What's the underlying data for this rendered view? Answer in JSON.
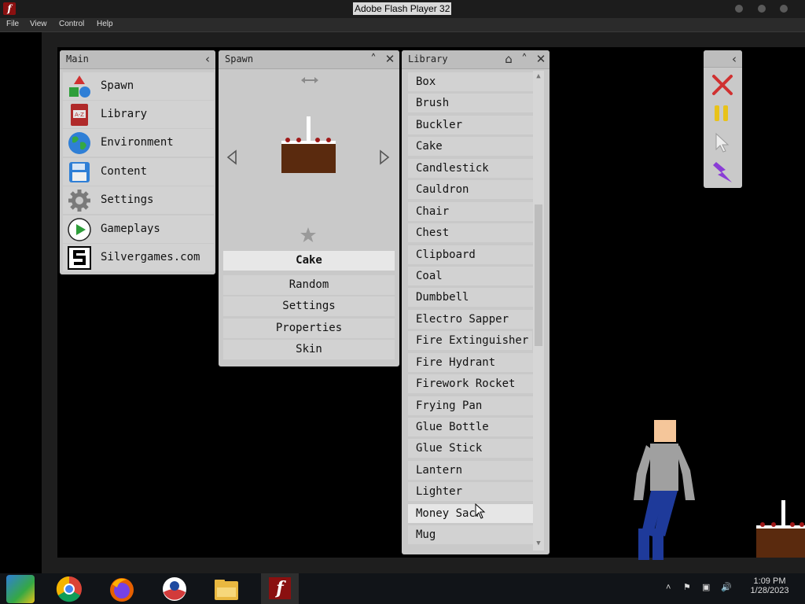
{
  "window": {
    "title": "Adobe Flash Player 32"
  },
  "menu": [
    "File",
    "View",
    "Control",
    "Help"
  ],
  "main_panel": {
    "title": "Main",
    "items": [
      {
        "label": "Spawn",
        "icon": "shapes-icon"
      },
      {
        "label": "Library",
        "icon": "book-icon"
      },
      {
        "label": "Environment",
        "icon": "globe-icon"
      },
      {
        "label": "Content",
        "icon": "floppy-disk-icon"
      },
      {
        "label": "Settings",
        "icon": "gear-icon"
      },
      {
        "label": "Gameplays",
        "icon": "play-icon"
      },
      {
        "label": "Silvergames.com",
        "icon": "silvergames-logo-icon"
      }
    ]
  },
  "spawn_panel": {
    "title": "Spawn",
    "selected": "Cake",
    "buttons": [
      "Random",
      "Settings",
      "Properties",
      "Skin"
    ]
  },
  "library_panel": {
    "title": "Library",
    "items": [
      "Box",
      "Brush",
      "Buckler",
      "Cake",
      "Candlestick",
      "Cauldron",
      "Chair",
      "Chest",
      "Clipboard",
      "Coal",
      "Dumbbell",
      "Electro Sapper",
      "Fire Extinguisher",
      "Fire Hydrant",
      "Firework Rocket",
      "Frying Pan",
      "Glue Bottle",
      "Glue Stick",
      "Lantern",
      "Lighter",
      "Money Sack",
      "Mug"
    ],
    "hovered": "Money Sack"
  },
  "tools": [
    "delete-icon",
    "pause-icon",
    "cursor-icon",
    "lightning-icon"
  ],
  "colors": {
    "panel": "#c9c9c9",
    "cake": "#5a2a0e",
    "delete": "#d03030",
    "pause": "#e8c21a",
    "lightning": "#8a3cd6",
    "person_shirt": "#a0a0a0",
    "person_pants": "#1e3a9a",
    "person_skin": "#f5c69a"
  },
  "taskbar": {
    "apps": [
      "files-icon",
      "chrome-icon",
      "firefox-icon",
      "obama-logo-icon",
      "folder-icon",
      "flash-player-icon"
    ],
    "time": "1:09 PM",
    "date": "1/28/2023"
  }
}
